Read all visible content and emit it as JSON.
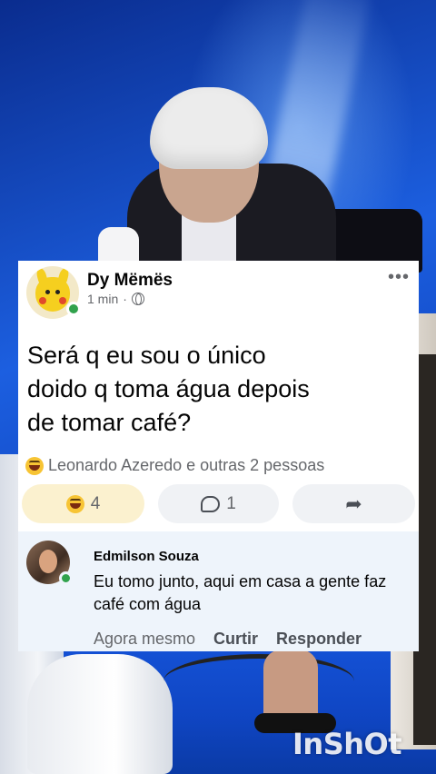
{
  "post": {
    "page_name": "Dy Mëmës",
    "time": "1 min",
    "separator": "·",
    "text": "Será q eu sou o único\ndoido q toma água depois\nde tomar café?",
    "reactions_summary": "Leonardo Azeredo e outras 2 pessoas",
    "actions": {
      "reaction_count": "4",
      "comment_count": "1"
    },
    "more_glyph": "•••"
  },
  "comment": {
    "author": "Edmilson Souza",
    "text": "Eu tomo junto, aqui em casa a gente faz café com água",
    "time": "Agora mesmo",
    "like_label": "Curtir",
    "reply_label": "Responder"
  },
  "watermark": "InShOt",
  "colors": {
    "online": "#31a24c",
    "secondary_text": "#65676b",
    "reaction_button_bg": "#fbf1cf",
    "comment_bg": "#eef4fb",
    "background_blue": "#1c5fe0"
  },
  "icons": {
    "reaction": "haha-emoji-icon",
    "comment": "comment-bubble-icon",
    "share": "share-arrow-icon",
    "privacy": "globe-icon",
    "more": "more-options-icon"
  }
}
